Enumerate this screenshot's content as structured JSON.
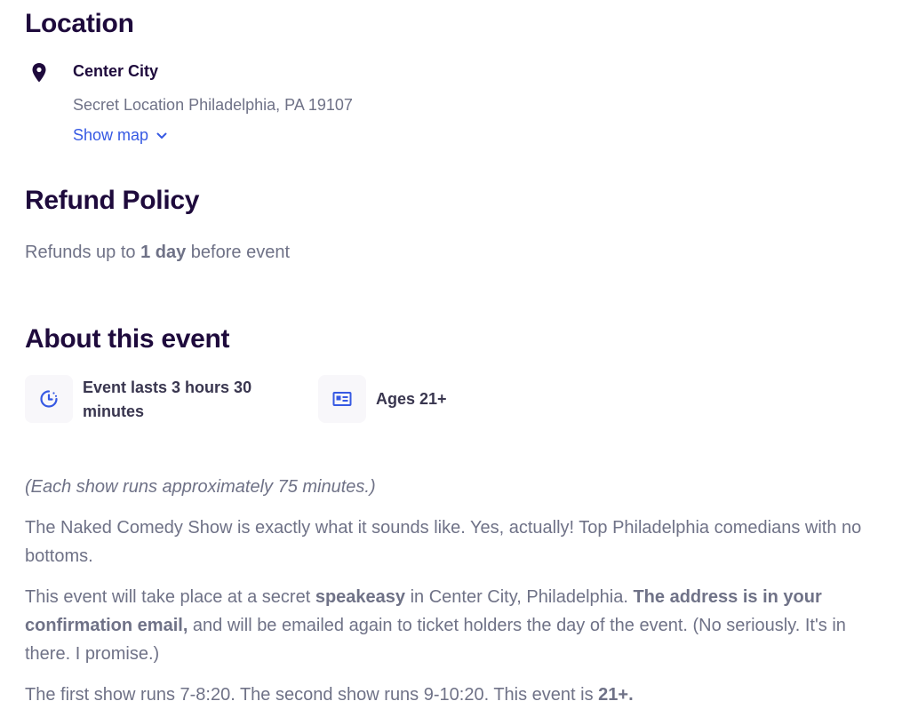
{
  "location": {
    "title": "Location",
    "venue_name": "Center City",
    "address": "Secret Location Philadelphia, PA 19107",
    "show_map_label": "Show map"
  },
  "refund": {
    "title": "Refund Policy",
    "text_before": "Refunds up to ",
    "text_bold": "1 day",
    "text_after": " before event"
  },
  "about": {
    "title": "About this event",
    "duration_label": "Event lasts 3 hours 30 minutes",
    "ages_label": "Ages 21+",
    "note": "(Each show runs approximately 75 minutes.)",
    "para1": "The Naked Comedy Show is exactly what it sounds like. Yes, actually! Top Philadelphia comedians with no bottoms.",
    "para2": {
      "part1": "This event will take place at a secret ",
      "bold1": "speakeasy",
      "part2": " in Center City, Philadelphia. ",
      "bold2": "The address is in your confirmation email,",
      "part3": " and will be emailed again to ticket holders the day of the event. (No seriously. It's in there. I promise.)"
    },
    "para3": {
      "part1": "The first show runs 7-8:20. The second show runs 9-10:20. This event is ",
      "bold1": "21+."
    }
  },
  "icons": {
    "pin": "map-pin-icon",
    "chevron": "chevron-down-icon",
    "clock": "clock-icon",
    "id": "id-card-icon"
  },
  "colors": {
    "heading": "#1e0a3c",
    "muted": "#6f7287",
    "link": "#3659e3",
    "tile_bg": "#f8f7fa"
  }
}
